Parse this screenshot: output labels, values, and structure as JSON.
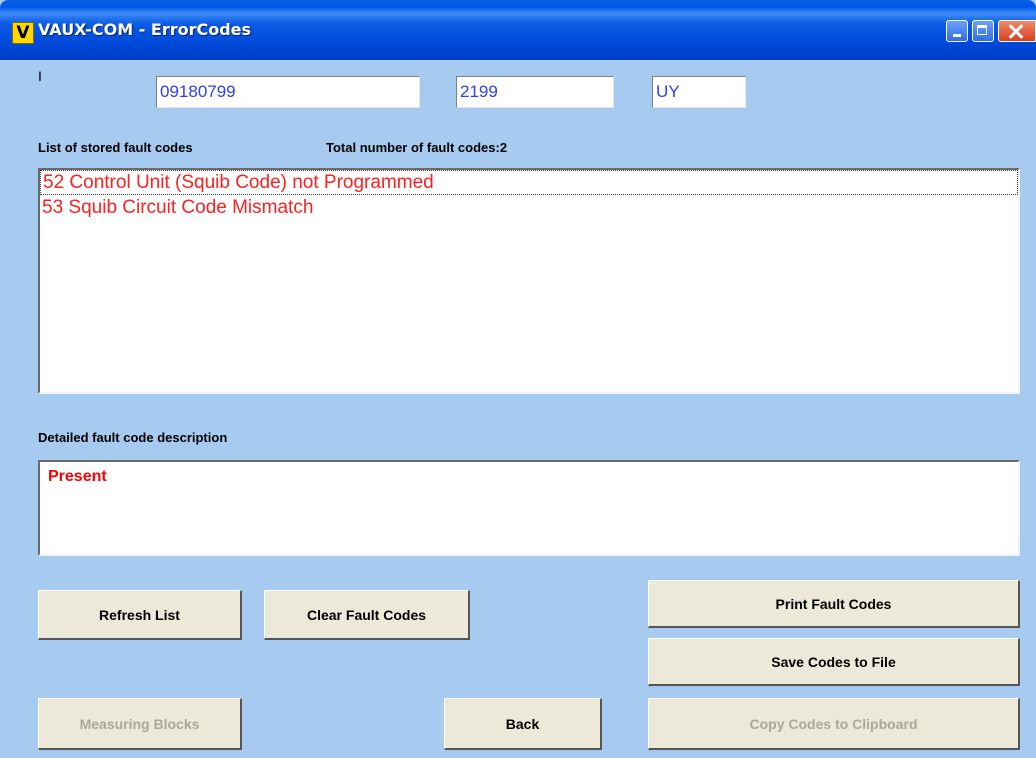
{
  "window": {
    "title": "VAUX-COM - ErrorCodes",
    "app_icon_letter": "V"
  },
  "fields": {
    "small_label": "I",
    "field1": "09180799",
    "field2": "2199",
    "field3": "UY"
  },
  "list": {
    "caption": "List of stored fault codes",
    "total_label": "Total number of fault codes:2",
    "items": [
      {
        "text": "52  Control Unit (Squib Code) not Programmed"
      },
      {
        "text": "53  Squib Circuit Code Mismatch"
      }
    ],
    "selected_index": 0,
    "item_color": "#ff2020"
  },
  "detail": {
    "caption": "Detailed fault code description",
    "text": "Present"
  },
  "buttons": {
    "refresh": "Refresh List",
    "clear": "Clear Fault Codes",
    "print": "Print Fault Codes",
    "save": "Save Codes to File",
    "measuring": "Measuring Blocks",
    "back": "Back",
    "copy": "Copy Codes to Clipboard"
  },
  "colors": {
    "background": "#a6caf0",
    "titlebar": "#0058ee",
    "field_text": "#2f3ff0",
    "fault_text": "#ff0000"
  }
}
